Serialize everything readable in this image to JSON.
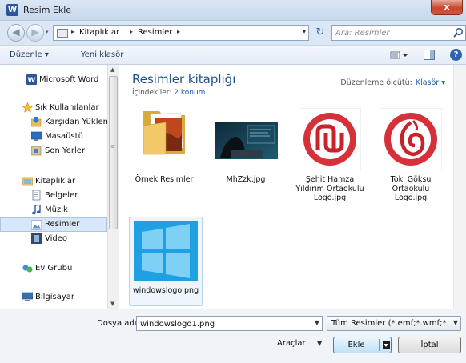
{
  "window": {
    "title": "Resim Ekle",
    "app_icon_letter": "W",
    "close_glyph": "x"
  },
  "address": {
    "back_glyph": "◀",
    "forward_glyph": "▶",
    "arrow_glyph": "▸",
    "parts": [
      "Kitaplıklar",
      "Resimler"
    ],
    "dropdown_glyph": "▾",
    "refresh_glyph": "↻",
    "search_placeholder": "Ara: Resimler"
  },
  "toolbar": {
    "organize_label": "Düzenle ▾",
    "new_folder_label": "Yeni klasör",
    "help_glyph": "?"
  },
  "nav": {
    "items": [
      {
        "label": "Microsoft Word",
        "icon": "word-icon"
      },
      {
        "label": "Sık Kullanılanlar",
        "icon": "star-icon"
      },
      {
        "label": "Karşıdan Yüklem",
        "icon": "downloads-icon"
      },
      {
        "label": "Masaüstü",
        "icon": "desktop-icon"
      },
      {
        "label": "Son Yerler",
        "icon": "recent-places-icon"
      },
      {
        "label": "Kitaplıklar",
        "icon": "libraries-icon"
      },
      {
        "label": "Belgeler",
        "icon": "documents-icon"
      },
      {
        "label": "Müzik",
        "icon": "music-icon"
      },
      {
        "label": "Resimler",
        "icon": "pictures-icon"
      },
      {
        "label": "Video",
        "icon": "video-icon"
      },
      {
        "label": "Ev Grubu",
        "icon": "homegroup-icon"
      },
      {
        "label": "Bilgisayar",
        "icon": "computer-icon"
      }
    ],
    "selected": "Resimler"
  },
  "content": {
    "library_title": "Resimler kitaplığı",
    "includes_label": "İçindekiler:",
    "includes_count": "2 konum",
    "arrange_label": "Düzenleme ölçütü:",
    "arrange_value": "Klasör ▾",
    "items": [
      {
        "caption": "Örnek Resimler",
        "type": "folder"
      },
      {
        "caption": "MhZzk.jpg",
        "type": "image"
      },
      {
        "caption": "Şehit Hamza Yıldırım Ortaokulu Logo.jpg",
        "type": "logo"
      },
      {
        "caption": "Toki Göksu Ortaokulu Logo.jpg",
        "type": "logo"
      },
      {
        "caption": "windowslogo.png",
        "type": "image"
      }
    ],
    "selected": "windowslogo.png"
  },
  "bottom": {
    "filename_label": "Dosya adı:",
    "filename_value": "windowslogo1.png",
    "filetype_value": "Tüm Resimler (*.emf;*.wmf;*.jp",
    "tools_label": "Araçlar",
    "insert_label": "Ekle",
    "cancel_label": "İptal"
  },
  "colors": {
    "accent": "#1e4f8b",
    "link": "#1e5aa8",
    "close": "#c9462c",
    "windows_blue": "#1fa0e3"
  }
}
